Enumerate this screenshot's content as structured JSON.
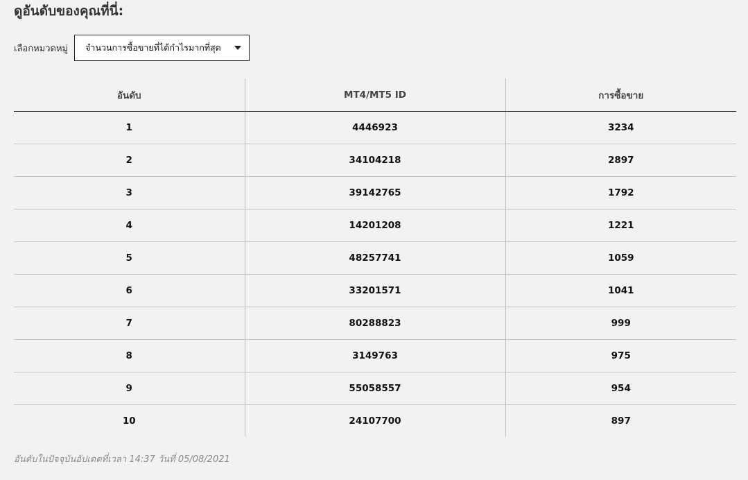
{
  "header": {
    "title": "ดูอันดับของคุณที่นี่:"
  },
  "filter": {
    "label": "เลือกหมวดหมู่",
    "selected": "จำนวนการซื้อขายที่ได้กำไรมากที่สุด"
  },
  "table": {
    "columns": [
      "อันดับ",
      "MT4/MT5 ID",
      "การซื้อขาย"
    ],
    "rows": [
      [
        "1",
        "4446923",
        "3234"
      ],
      [
        "2",
        "34104218",
        "2897"
      ],
      [
        "3",
        "39142765",
        "1792"
      ],
      [
        "4",
        "14201208",
        "1221"
      ],
      [
        "5",
        "48257741",
        "1059"
      ],
      [
        "6",
        "33201571",
        "1041"
      ],
      [
        "7",
        "80288823",
        "999"
      ],
      [
        "8",
        "3149763",
        "975"
      ],
      [
        "9",
        "55058557",
        "954"
      ],
      [
        "10",
        "24107700",
        "897"
      ]
    ]
  },
  "footnote": "อันดับในปัจจุบันอัปเดตที่เวลา 14:37 วันที่ 05/08/2021",
  "icons": {
    "dropdown": "chevron-down-icon"
  }
}
